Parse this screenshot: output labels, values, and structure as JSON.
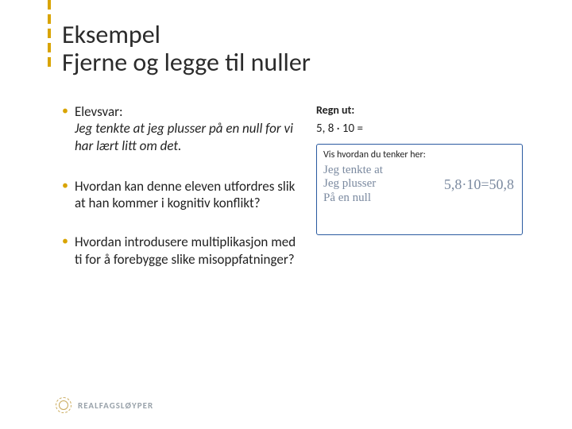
{
  "title": {
    "line1": "Eksempel",
    "line2": "Fjerne og legge til nuller"
  },
  "bullets": [
    {
      "label": "Elevsvar:",
      "italic": "Jeg tenkte at jeg plusser på en null for vi har lært litt om det."
    },
    {
      "text": "Hvordan kan denne eleven utfordres slik at han kommer i kognitiv konflikt?"
    },
    {
      "text": "Hvordan introdusere multiplikasjon med ti for å forebygge slike misoppfatninger?"
    }
  ],
  "task": {
    "label": "Regn ut:",
    "equation": "5, 8 · 10 =",
    "workbox_label": "Vis hvordan du tenker her:",
    "handwriting_lines": [
      "Jeg tenkte at",
      "Jeg plusser",
      "På en null"
    ],
    "handwriting_equation": "5,8·10=50,8"
  },
  "footer": {
    "brand": "REALFAGSLØYPER"
  }
}
